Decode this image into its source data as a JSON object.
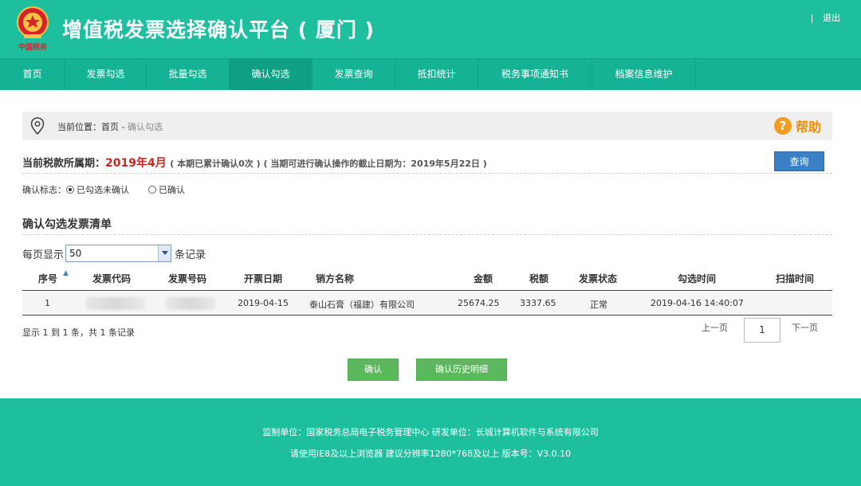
{
  "header": {
    "title": "增值税发票选择确认平台 ( 厦门 )",
    "logo_text": "中国税务",
    "top_right_sep": "|",
    "logout": "退出"
  },
  "nav": {
    "items": [
      {
        "label": "首页"
      },
      {
        "label": "发票勾选"
      },
      {
        "label": "批量勾选"
      },
      {
        "label": "确认勾选",
        "active": true
      },
      {
        "label": "发票查询"
      },
      {
        "label": "抵扣统计"
      },
      {
        "label": "税务事项通知书"
      },
      {
        "label": "档案信息维护"
      }
    ]
  },
  "breadcrumb": {
    "prefix": "当前位置：",
    "home": "首页",
    "sep": " - ",
    "current": "确认勾选"
  },
  "help": {
    "icon": "?",
    "label": "帮助"
  },
  "period": {
    "label": "当前税款所属期：",
    "value": "2019年4月",
    "note": "( 本期已累计确认0次 ) ( 当期可进行确认操作的截止日期为：2019年5月22日 )"
  },
  "query_button": "查询",
  "confirm_flag": {
    "label": "确认标志：",
    "options": [
      {
        "label": "已勾选未确认",
        "selected": true
      },
      {
        "label": "已确认",
        "selected": false
      }
    ]
  },
  "list_title": "确认勾选发票清单",
  "page_size": {
    "prefix": "每页显示",
    "value": "50",
    "suffix": "条记录"
  },
  "table": {
    "headers": {
      "index": "序号",
      "code": "发票代码",
      "number": "发票号码",
      "date": "开票日期",
      "seller": "销方名称",
      "amount": "金额",
      "tax": "税额",
      "status": "发票状态",
      "select_time": "勾选时间",
      "scan_time": "扫描时间"
    },
    "sort_icon": "▲",
    "rows": [
      {
        "index": "1",
        "date": "2019-04-15",
        "seller": "泰山石膏（福建）有限公司",
        "amount": "25674.25",
        "tax": "3337.65",
        "status": "正常",
        "select_time": "2019-04-16 14:40:07",
        "scan_time": ""
      }
    ]
  },
  "summary": "显示 1 到 1 条，共 1 条记录",
  "pager": {
    "prev": "上一页",
    "page": "1",
    "next": "下一页"
  },
  "actions": {
    "confirm": "确认",
    "history": "确认历史明细"
  },
  "footer": {
    "line1": "监制单位：国家税务总局电子税务管理中心    研发单位：长城计算机软件与系统有限公司",
    "line2": "请使用IE8及以上浏览器    建议分辨率1280*768及以上    版本号：V3.0.10"
  },
  "colors": {
    "brand": "#1dbf9f",
    "nav": "#14b396",
    "period_value": "#c8261c",
    "query_button": "#3a80c6",
    "action_button": "#5cb85c",
    "help": "#f08d00"
  }
}
